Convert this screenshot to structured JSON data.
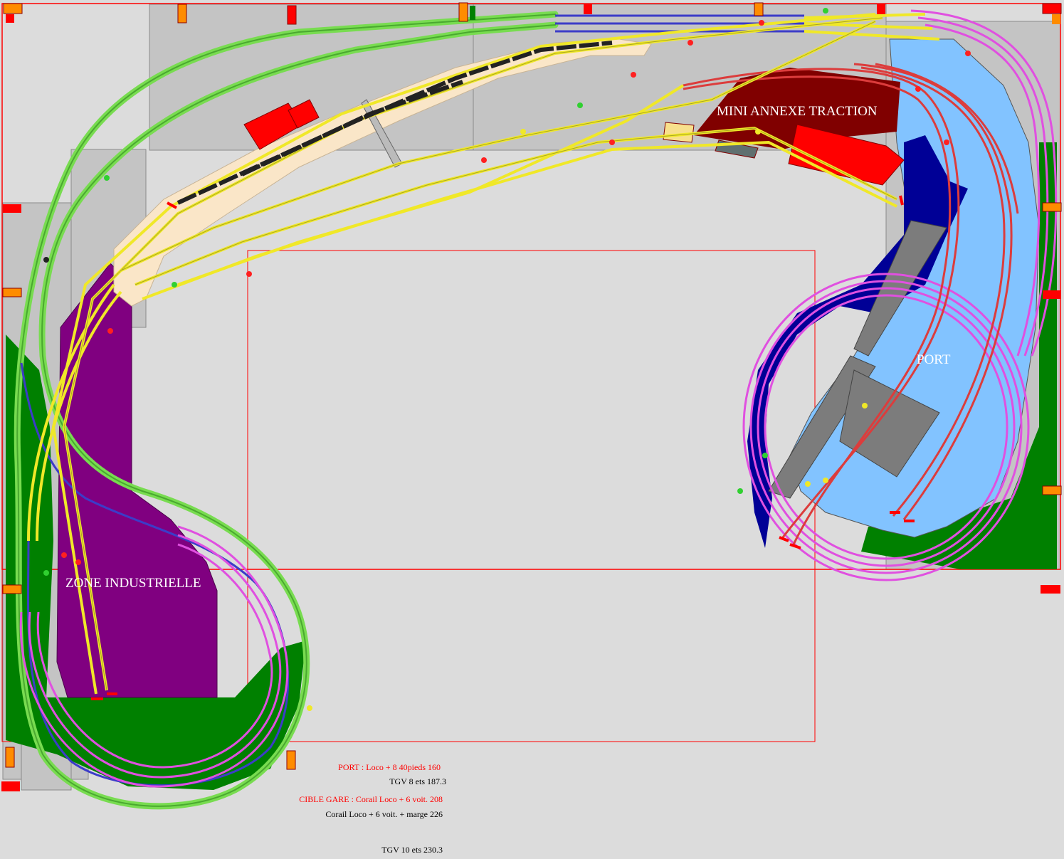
{
  "labels": {
    "annexe": "MINI ANNEXE TRACTION",
    "port": "PORT",
    "zone_industrielle": "ZONE INDUSTRIELLE"
  },
  "notes": [
    {
      "text": "PORT : Loco + 8 40pieds 160",
      "color": "#ff0000"
    },
    {
      "text": "TGV 8 ets 187.3",
      "color": "#000000"
    },
    {
      "text": "CIBLE GARE : Corail Loco + 6 voit. 208",
      "color": "#ff0000"
    },
    {
      "text": "Corail Loco + 6 voit. + marge 226",
      "color": "#000000"
    },
    {
      "text": "TGV 10 ets 230.3",
      "color": "#000000"
    }
  ],
  "colors": {
    "background": "#dcdcdc",
    "track_yellow": "#f0e828",
    "track_green": "#78dc50",
    "track_blue": "#3c3cc8",
    "track_magenta": "#e050e0",
    "track_red": "#dc3c3c",
    "industrial_zone": "#800080",
    "water": "#82c3ff",
    "deep_water": "#000096",
    "grass": "#008000",
    "annexe_roof": "#800000",
    "platform": "#fae6c8",
    "building_red": "#ff0000",
    "frame": "#ff0000"
  }
}
